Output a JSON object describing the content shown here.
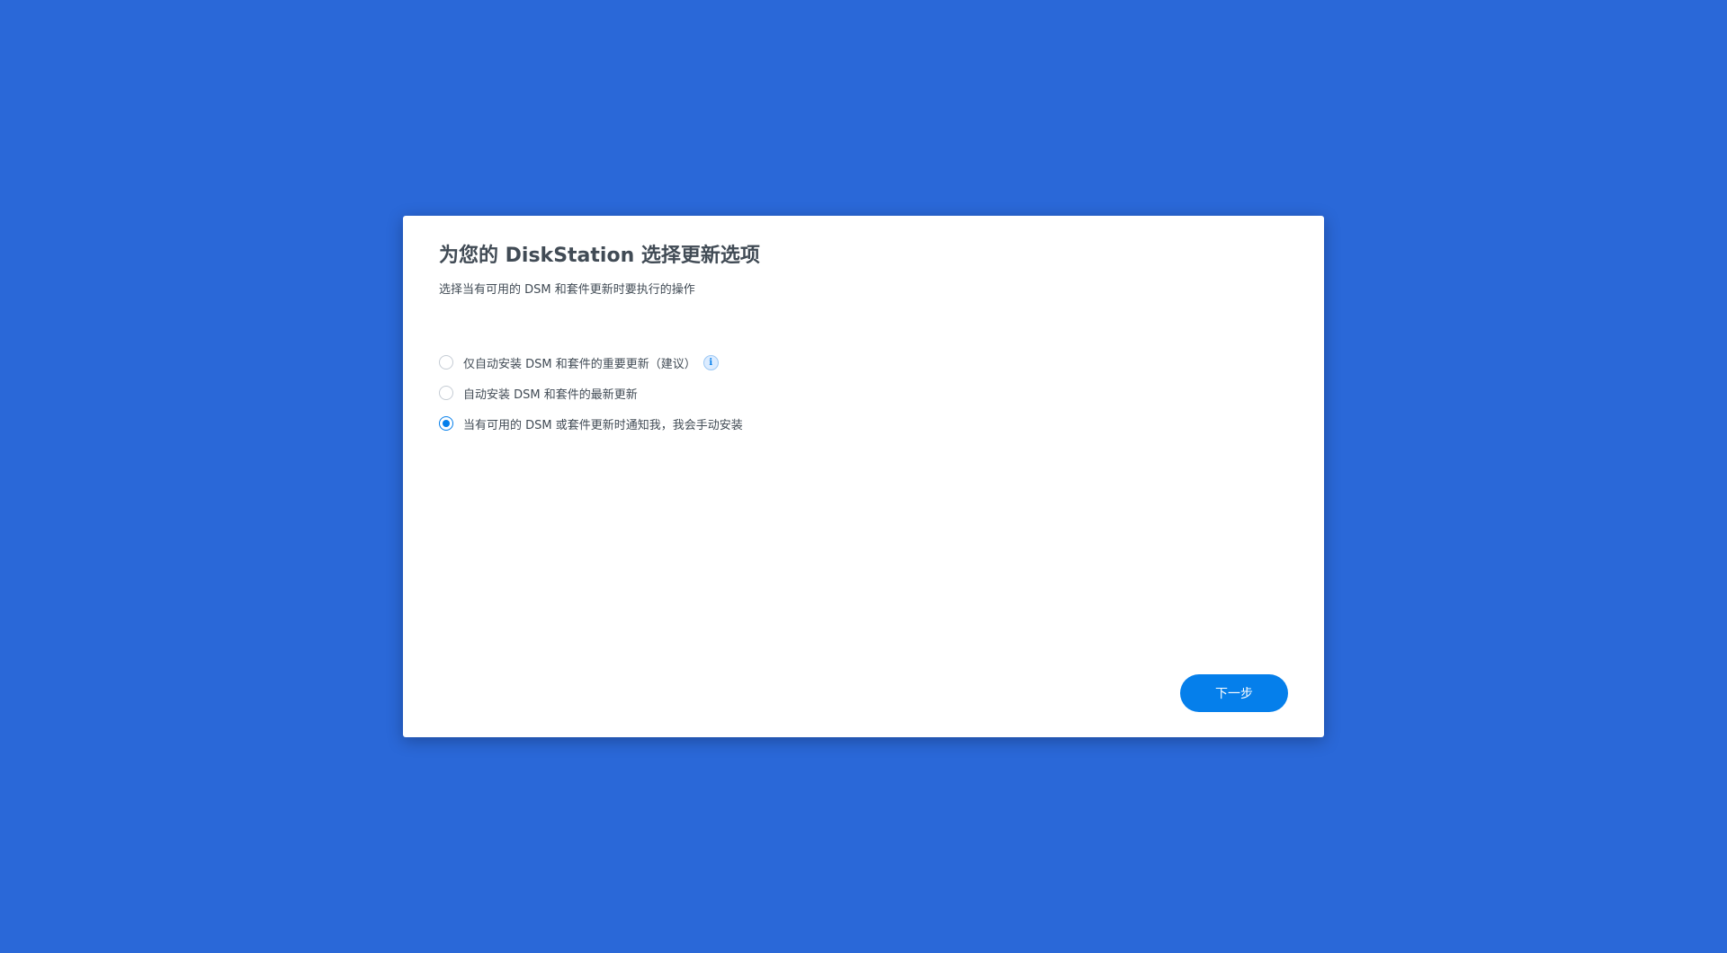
{
  "dialog": {
    "title": "为您的 DiskStation 选择更新选项",
    "subtitle": "选择当有可用的 DSM 和套件更新时要执行的操作",
    "options": [
      {
        "label": "仅自动安装 DSM 和套件的重要更新（建议）",
        "selected": false,
        "has_info_icon": true
      },
      {
        "label": "自动安装 DSM 和套件的最新更新",
        "selected": false,
        "has_info_icon": false
      },
      {
        "label": "当有可用的 DSM 或套件更新时通知我，我会手动安装",
        "selected": true,
        "has_info_icon": false
      }
    ],
    "info_icon_glyph": "i",
    "next_label": "下一步"
  },
  "colors": {
    "background": "#2a68d8",
    "accent": "#057feb",
    "text": "#414b55"
  }
}
